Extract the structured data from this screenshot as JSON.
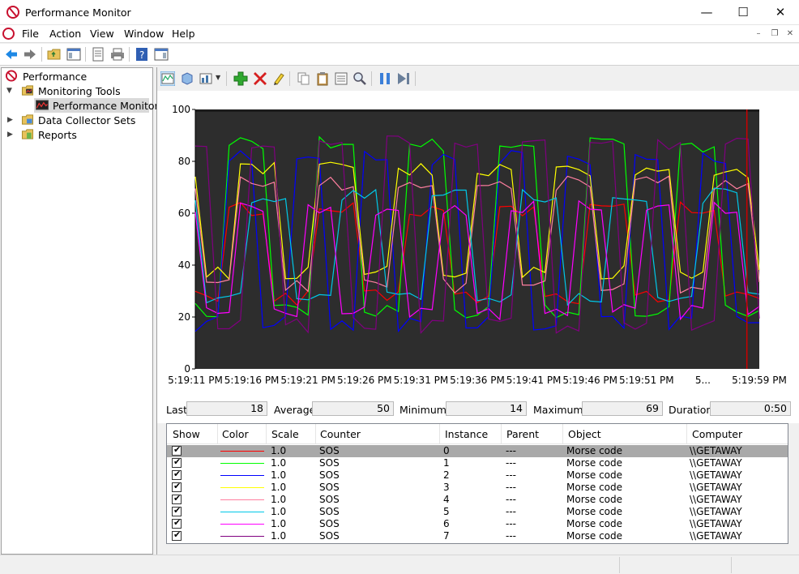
{
  "window": {
    "title": "Performance Monitor",
    "controls": {
      "minimize": "—",
      "maximize": "☐",
      "close": "✕"
    }
  },
  "menu": {
    "items": [
      "File",
      "Action",
      "View",
      "Window",
      "Help"
    ],
    "mdi": {
      "minimize": "–",
      "restore": "❐",
      "close": "✕"
    }
  },
  "tree": {
    "root": "Performance",
    "items": [
      {
        "label": "Monitoring Tools",
        "expanded": true
      },
      {
        "label": "Performance Monitor",
        "selected": true
      },
      {
        "label": "Data Collector Sets",
        "expanded": false
      },
      {
        "label": "Reports",
        "expanded": false
      }
    ]
  },
  "graph": {
    "y_ticks": [
      "100",
      "80",
      "60",
      "40",
      "20",
      "0"
    ],
    "x_ticks": [
      "5:19:11 PM",
      "5:19:16 PM",
      "5:19:21 PM",
      "5:19:26 PM",
      "5:19:31 PM",
      "5:19:36 PM",
      "5:19:41 PM",
      "5:19:46 PM",
      "5:19:51 PM",
      "5...",
      "5:19:59 PM"
    ],
    "background": "#2d2d2d",
    "cursor_color": "#cc0000"
  },
  "stats": {
    "last_label": "Last",
    "last": "18",
    "average_label": "Average",
    "average": "50",
    "minimum_label": "Minimum",
    "minimum": "14",
    "maximum_label": "Maximum",
    "maximum": "69",
    "duration_label": "Duration",
    "duration": "0:50"
  },
  "counters": {
    "headers": [
      "Show",
      "Color",
      "Scale",
      "Counter",
      "Instance",
      "Parent",
      "Object",
      "Computer"
    ],
    "rows": [
      {
        "color": "#ff0000",
        "scale": "1.0",
        "counter": "SOS",
        "instance": "0",
        "parent": "---",
        "object": "Morse code",
        "computer": "\\\\GETAWAY"
      },
      {
        "color": "#00ff00",
        "scale": "1.0",
        "counter": "SOS",
        "instance": "1",
        "parent": "---",
        "object": "Morse code",
        "computer": "\\\\GETAWAY"
      },
      {
        "color": "#0000ff",
        "scale": "1.0",
        "counter": "SOS",
        "instance": "2",
        "parent": "---",
        "object": "Morse code",
        "computer": "\\\\GETAWAY"
      },
      {
        "color": "#ffff00",
        "scale": "1.0",
        "counter": "SOS",
        "instance": "3",
        "parent": "---",
        "object": "Morse code",
        "computer": "\\\\GETAWAY"
      },
      {
        "color": "#ff7f9f",
        "scale": "1.0",
        "counter": "SOS",
        "instance": "4",
        "parent": "---",
        "object": "Morse code",
        "computer": "\\\\GETAWAY"
      },
      {
        "color": "#00c8e8",
        "scale": "1.0",
        "counter": "SOS",
        "instance": "5",
        "parent": "---",
        "object": "Morse code",
        "computer": "\\\\GETAWAY"
      },
      {
        "color": "#ff00ff",
        "scale": "1.0",
        "counter": "SOS",
        "instance": "6",
        "parent": "---",
        "object": "Morse code",
        "computer": "\\\\GETAWAY"
      },
      {
        "color": "#800080",
        "scale": "1.0",
        "counter": "SOS",
        "instance": "7",
        "parent": "---",
        "object": "Morse code",
        "computer": "\\\\GETAWAY"
      }
    ]
  }
}
